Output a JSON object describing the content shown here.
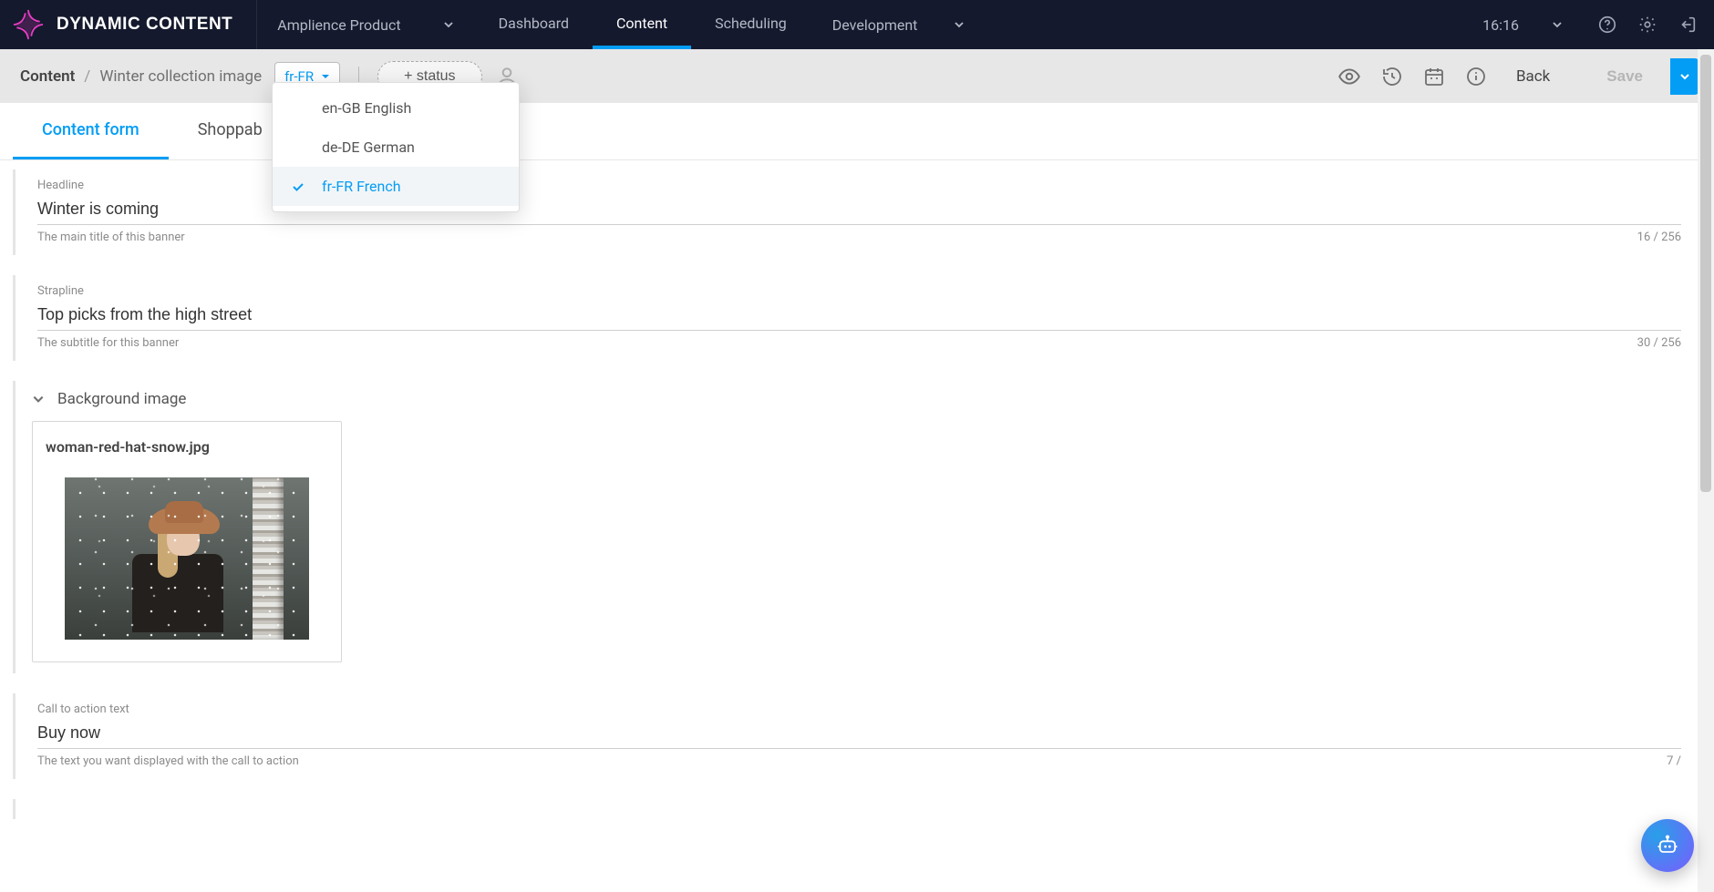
{
  "app": {
    "name": "DYNAMIC CONTENT"
  },
  "org_select": {
    "label": "Amplience Product"
  },
  "nav": [
    {
      "label": "Dashboard",
      "active": false
    },
    {
      "label": "Content",
      "active": true
    },
    {
      "label": "Scheduling",
      "active": false
    }
  ],
  "env_select": {
    "label": "Development"
  },
  "clock": {
    "time": "16:16"
  },
  "breadcrumb": {
    "root": "Content",
    "sep": "/",
    "leaf": "Winter collection image"
  },
  "locale_chip": {
    "value": "fr-FR"
  },
  "status_button": {
    "label": "+ status"
  },
  "actions": {
    "back": "Back",
    "save": "Save"
  },
  "tabs": [
    {
      "label": "Content form",
      "active": true
    },
    {
      "label": "Shoppab",
      "active": false
    }
  ],
  "locale_dropdown": {
    "options": [
      {
        "label": "en-GB English",
        "selected": false
      },
      {
        "label": "de-DE German",
        "selected": false
      },
      {
        "label": "fr-FR French",
        "selected": true
      }
    ]
  },
  "fields": {
    "headline": {
      "label": "Headline",
      "value": "Winter is coming",
      "help": "The main title of this banner",
      "count": "16 / 256"
    },
    "strapline": {
      "label": "Strapline",
      "value": "Top picks from the high street",
      "help": "The subtitle for this banner",
      "count": "30 / 256"
    },
    "background_image": {
      "section_label": "Background image",
      "filename": "woman-red-hat-snow.jpg"
    },
    "cta_text": {
      "label": "Call to action text",
      "value": "Buy now",
      "help": "The text you want displayed with the call to action",
      "count": "7 /"
    }
  }
}
